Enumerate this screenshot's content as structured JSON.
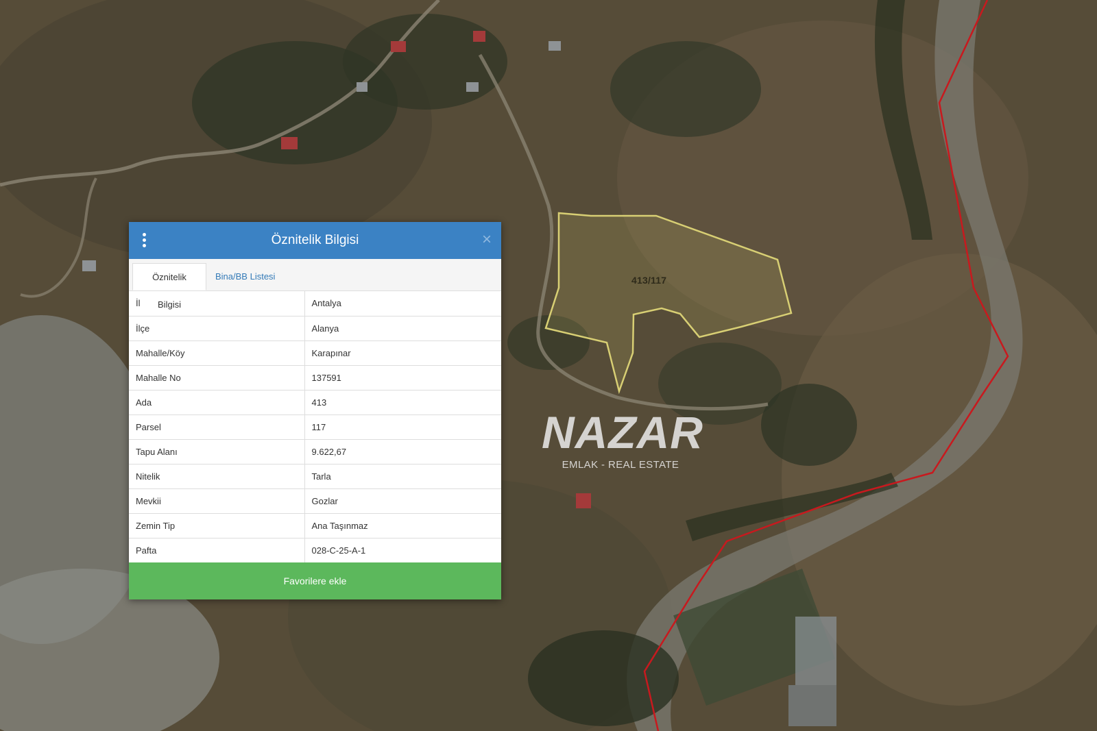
{
  "map": {
    "parcel_label": "413/117",
    "colors": {
      "terrain": "#5a4f3a",
      "vegetation": "#2b3122",
      "parcel_outline": "#d8cf74",
      "boundary_line": "#c8191e",
      "rock": "#8a8b86"
    }
  },
  "watermark": {
    "logo": "NAZAR",
    "subtitle": "EMLAK - REAL ESTATE"
  },
  "panel": {
    "title": "Öznitelik Bilgisi",
    "menu_icon": "vertical-dots-icon",
    "close_icon": "close-icon",
    "close_symbol": "×",
    "header_color": "#3b82c4",
    "tabs": [
      {
        "label": "Öznitelik Bilgisi",
        "active": true
      },
      {
        "label": "Bina/BB Listesi",
        "active": false
      }
    ],
    "rows": [
      {
        "key": "İl",
        "value": "Antalya"
      },
      {
        "key": "İlçe",
        "value": "Alanya"
      },
      {
        "key": "Mahalle/Köy",
        "value": "Karapınar"
      },
      {
        "key": "Mahalle No",
        "value": "137591"
      },
      {
        "key": "Ada",
        "value": "413"
      },
      {
        "key": "Parsel",
        "value": "117"
      },
      {
        "key": "Tapu Alanı",
        "value": "9.622,67"
      },
      {
        "key": "Nitelik",
        "value": "Tarla"
      },
      {
        "key": "Mevkii",
        "value": "Gozlar"
      },
      {
        "key": "Zemin Tip",
        "value": "Ana Taşınmaz"
      },
      {
        "key": "Pafta",
        "value": "028-C-25-A-1"
      }
    ],
    "favorite_button": "Favorilere ekle",
    "favorite_color": "#5cb85c"
  }
}
